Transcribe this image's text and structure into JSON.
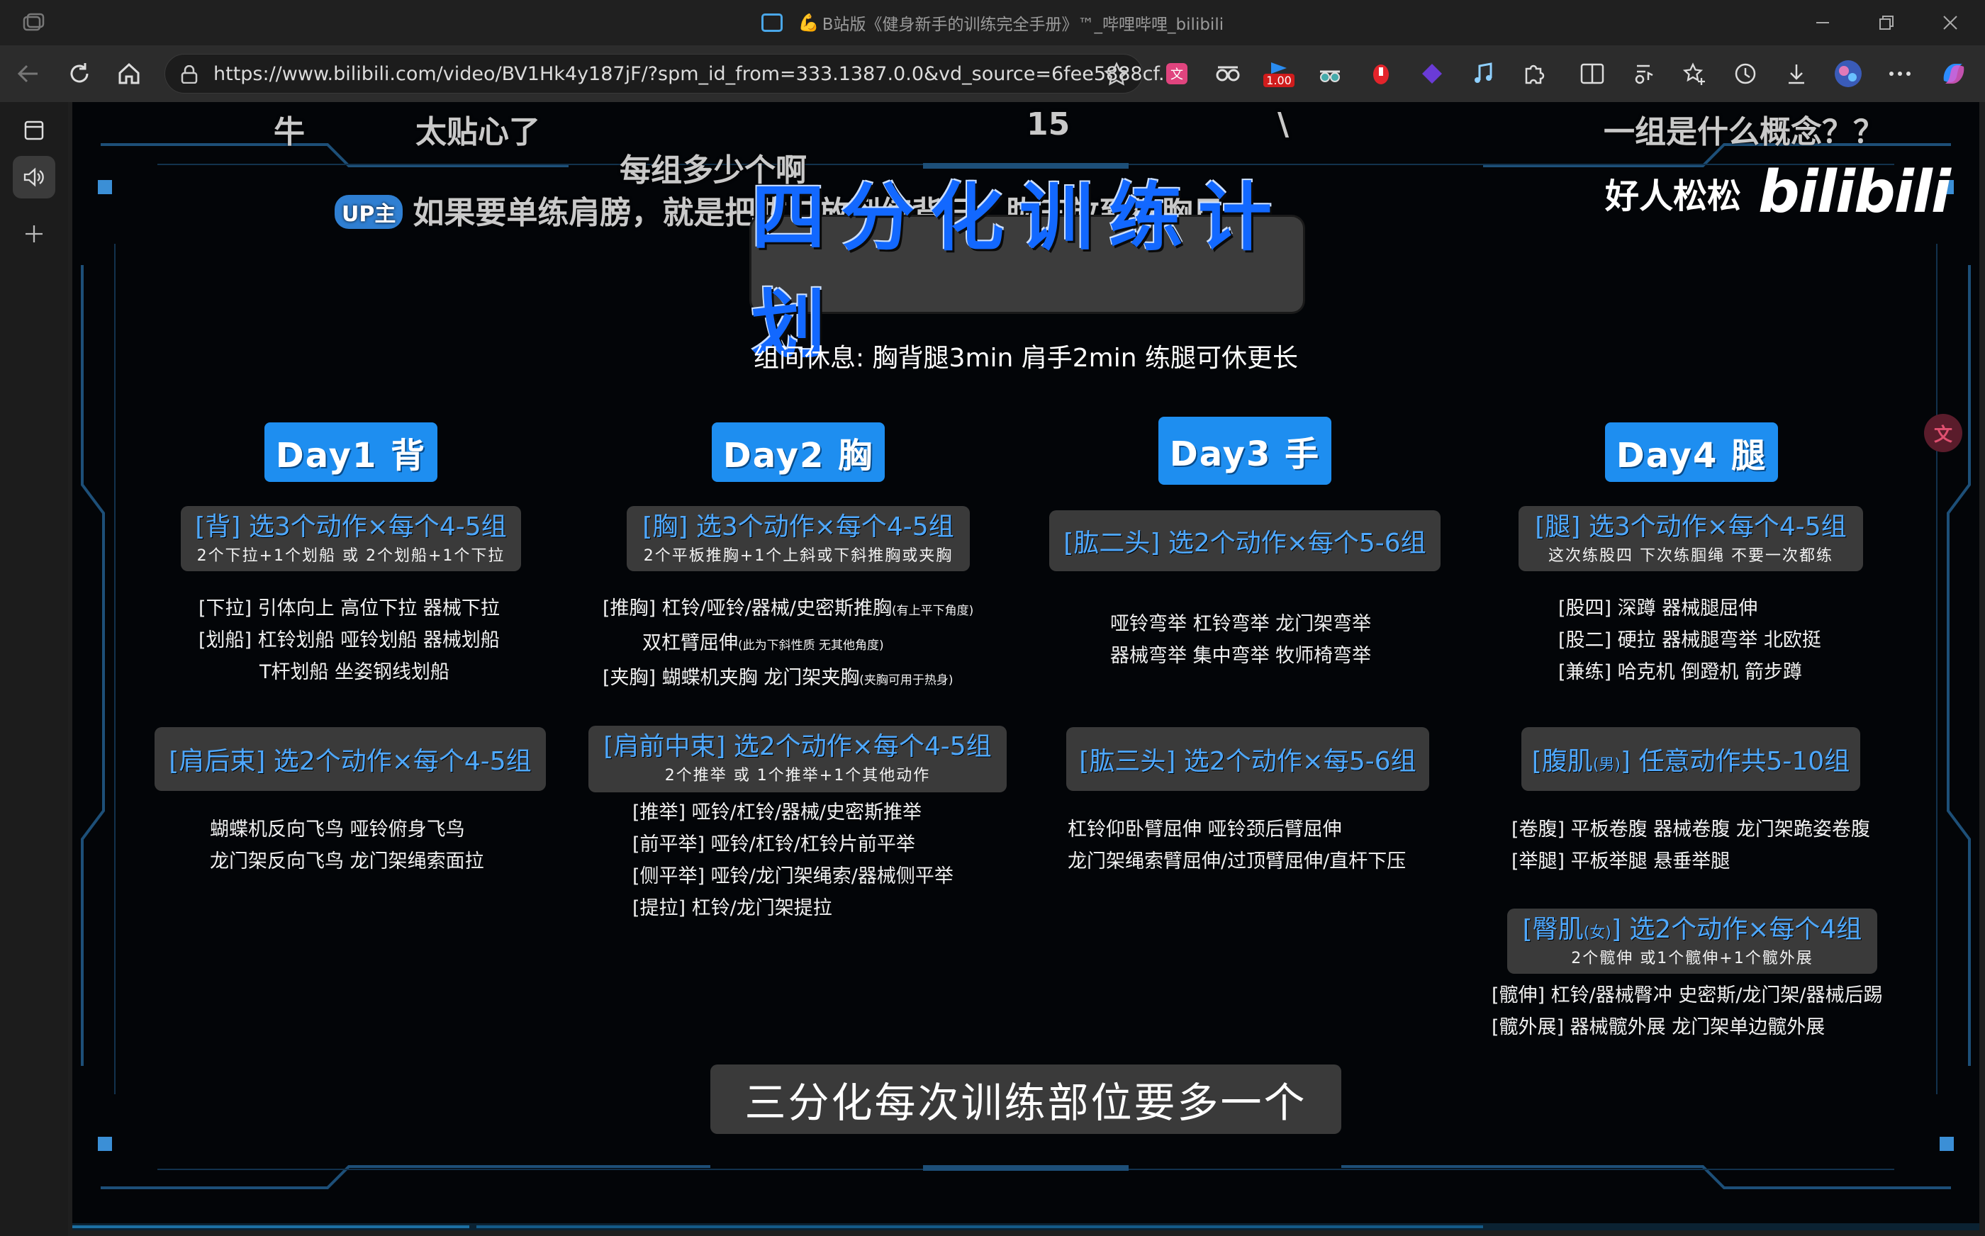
{
  "browser": {
    "window_title_prefix": "B站版《健身新手的训练完全手册》™_哔哩哔哩_bilibili",
    "url": "https://www.bilibili.com/video/BV1Hk4y187jF/?spm_id_from=333.1387.0.0&vd_source=6fee5888cf...",
    "ext_badge": "1.00",
    "colors": {
      "accent_blue": "#1e8ef0",
      "title_blue": "#1268ff",
      "section_blue": "#4ea8ff"
    }
  },
  "danmaku": {
    "d1": "牛",
    "d2": "太贴心了",
    "d3": "15",
    "d4": "\\",
    "d5": "一组是什么概念？？",
    "d6": "每组多少个啊",
    "up_tag": "UP主",
    "up_text": "如果要单练肩膀，就是把肱二放到练背日，肱三放到练胸日"
  },
  "watermark": {
    "user": "好人松松",
    "logo": "bilibili"
  },
  "plan": {
    "title": "四分化训练计划",
    "rest_note": "组间休息: 胸背腿3min  肩手2min  练腿可休更长",
    "days": [
      {
        "label": "Day1 背",
        "s1_title": "[背] 选3个动作×每个4-5组",
        "s1_sub": "2个下拉+1个划船 或 2个划船+1个下拉",
        "s1_lines": [
          "[下拉] 引体向上 高位下拉 器械下拉",
          "[划船] 杠铃划船 哑铃划船 器械划船",
          "T杆划船  坐姿钢线划船"
        ],
        "s2_title": "[肩后束] 选2个动作×每个4-5组",
        "s2_lines": [
          "蝴蝶机反向飞鸟 哑铃俯身飞鸟",
          "龙门架反向飞鸟 龙门架绳索面拉"
        ]
      },
      {
        "label": "Day2 胸",
        "s1_title": "[胸] 选3个动作×每个4-5组",
        "s1_sub": "2个平板推胸+1个上斜或下斜推胸或夹胸",
        "s1_lines": [
          "[推胸] 杠铃/哑铃/器械/史密斯推胸",
          "双杠臂屈伸",
          "[夹胸] 蝴蝶机夹胸 龙门架夹胸"
        ],
        "s1_notes": [
          "(有上平下角度)",
          "(此为下斜性质 无其他角度)",
          "(夹胸可用于热身)"
        ],
        "s2_title": "[肩前中束] 选2个动作×每个4-5组",
        "s2_sub": "2个推举 或 1个推举+1个其他动作",
        "s2_lines": [
          "[推举] 哑铃/杠铃/器械/史密斯推举",
          "[前平举] 哑铃/杠铃/杠铃片前平举",
          "[侧平举] 哑铃/龙门架绳索/器械侧平举",
          "[提拉] 杠铃/龙门架提拉"
        ]
      },
      {
        "label": "Day3 手",
        "s1_title": "[肱二头] 选2个动作×每个5-6组",
        "s1_lines": [
          "哑铃弯举 杠铃弯举 龙门架弯举",
          "器械弯举 集中弯举 牧师椅弯举"
        ],
        "s2_title": "[肱三头] 选2个动作×每5-6组",
        "s2_lines": [
          "杠铃仰卧臂屈伸 哑铃颈后臂屈伸",
          "龙门架绳索臂屈伸/过顶臂屈伸/直杆下压"
        ]
      },
      {
        "label": "Day4 腿",
        "s1_title": "[腿] 选3个动作×每个4-5组",
        "s1_sub": "这次练股四 下次练腘绳 不要一次都练",
        "s1_lines": [
          "[股四] 深蹲 器械腿屈伸",
          "[股二] 硬拉 器械腿弯举 北欧挺",
          "[兼练] 哈克机 倒蹬机 箭步蹲"
        ],
        "s2_title_a": "[腹肌",
        "s2_title_tag": "(男)",
        "s2_title_b": "] 任意动作共5-10组",
        "s2_lines": [
          "[卷腹] 平板卷腹 器械卷腹 龙门架跪姿卷腹",
          "[举腿] 平板举腿 悬垂举腿"
        ],
        "s3_title_a": "[臀肌",
        "s3_title_tag": "(女)",
        "s3_title_b": "] 选2个动作×每个4组",
        "s3_sub": "2个髋伸 或1个髋伸+1个髋外展",
        "s3_lines": [
          "[髋伸] 杠铃/器械臀冲 史密斯/龙门架/器械后踢",
          "[髋外展] 器械髋外展 龙门架单边髋外展"
        ]
      }
    ]
  },
  "subtitle": "三分化每次训练部位要多一个"
}
